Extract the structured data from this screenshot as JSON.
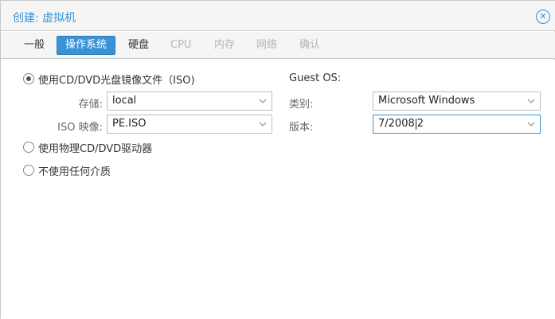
{
  "window": {
    "title": "创建: 虚拟机",
    "close_icon": "close-circle-icon"
  },
  "tabs": [
    {
      "label": "一般",
      "state": "normal"
    },
    {
      "label": "操作系统",
      "state": "active"
    },
    {
      "label": "硬盘",
      "state": "normal"
    },
    {
      "label": "CPU",
      "state": "disabled"
    },
    {
      "label": "内存",
      "state": "disabled"
    },
    {
      "label": "网络",
      "state": "disabled"
    },
    {
      "label": "确认",
      "state": "disabled"
    }
  ],
  "media": {
    "option_iso": "使用CD/DVD光盘镜像文件（ISO)",
    "option_physical": "使用物理CD/DVD驱动器",
    "option_none": "不使用任何介质",
    "storage_label": "存储:",
    "storage_value": "local",
    "iso_label": "ISO 映像:",
    "iso_value": "PE.ISO"
  },
  "guest_os": {
    "title": "Guest OS:",
    "type_label": "类别:",
    "type_value": "Microsoft Windows",
    "version_label": "版本:",
    "version_value_before_cursor": "7/2008",
    "version_value_after_cursor": "2"
  },
  "colors": {
    "accent": "#3892d4",
    "disabled_text": "#b5b5b5"
  }
}
